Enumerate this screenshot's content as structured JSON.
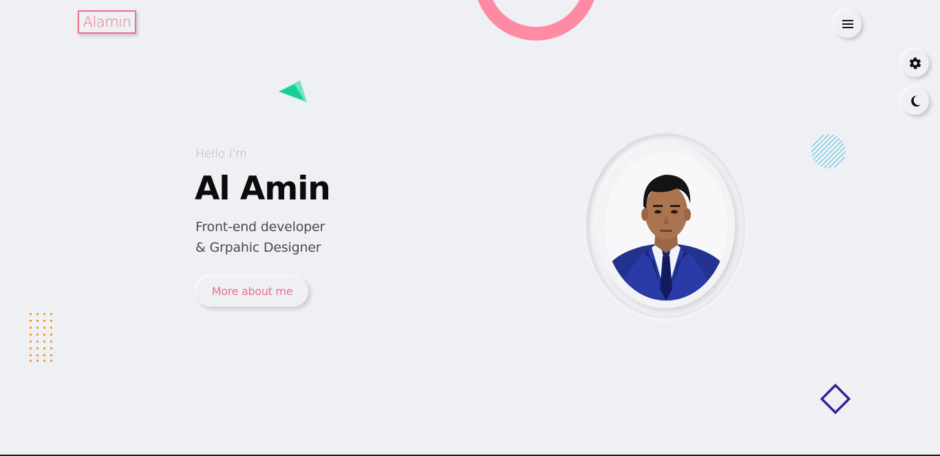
{
  "logo": {
    "text": "Alamin"
  },
  "header": {
    "menu_icon": "hamburger-menu-icon"
  },
  "side_controls": {
    "settings_icon": "gear-icon",
    "theme_icon": "moon-icon"
  },
  "hero": {
    "greeting": "Hello I'm",
    "name": "Al Amin",
    "role_line1": "Front-end developer",
    "role_line2": "& Grpahic Designer",
    "cta_label": "More about me"
  },
  "portrait": {
    "icon": "profile-photo"
  },
  "colors": {
    "accent_pink": "#ec6f8c",
    "ring_pink": "#ff8aa4",
    "triangle_green": "#1fd1a0",
    "dots_orange": "#f59a23",
    "stripes_cyan": "#63c8e0",
    "diamond_purple": "#3b1e96",
    "background": "#eff0f4"
  }
}
